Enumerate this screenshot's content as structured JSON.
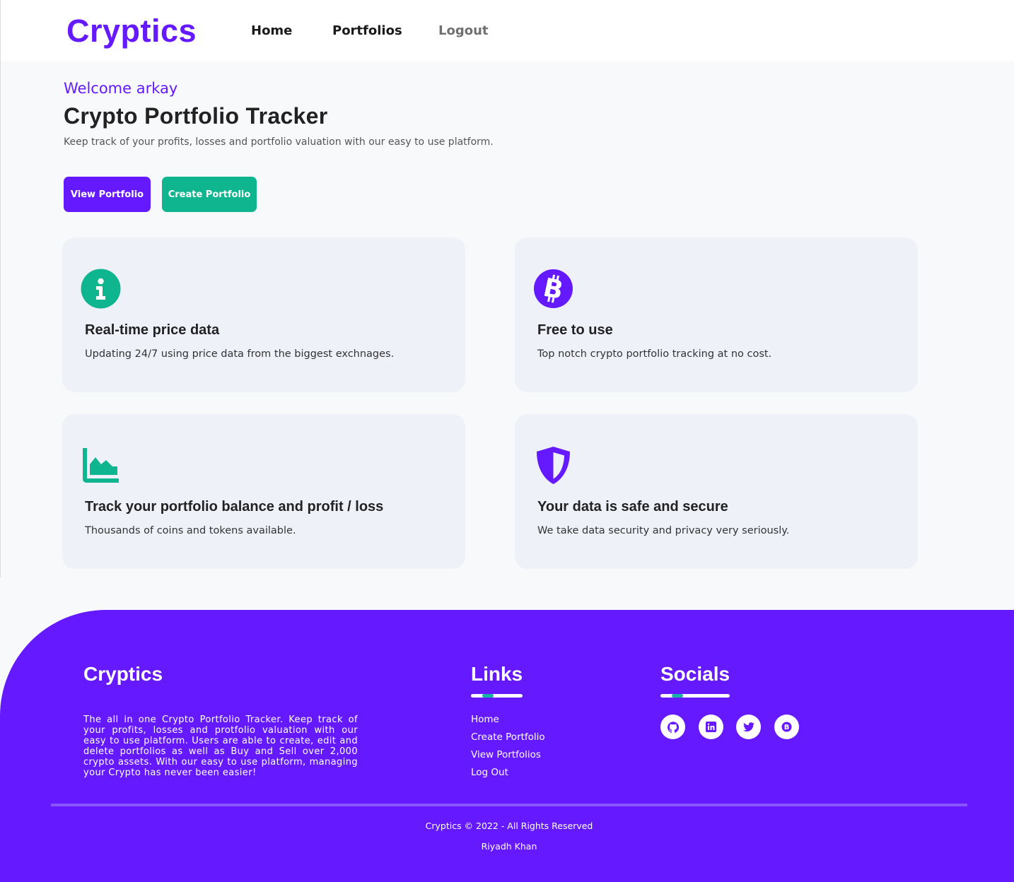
{
  "header": {
    "logo": "Cryptics",
    "nav": [
      {
        "label": "Home"
      },
      {
        "label": "Portfolios"
      },
      {
        "label": "Logout"
      }
    ]
  },
  "hero": {
    "welcome": "Welcome arkay",
    "title": "Crypto Portfolio Tracker",
    "subtitle": "Keep track of your profits, losses and portfolio valuation with our easy to use platform.",
    "buttons": {
      "view": "View Portfolio",
      "create": "Create Portfolio"
    }
  },
  "features": [
    {
      "icon": "info-icon",
      "title": "Real-time price data",
      "desc": "Updating 24/7 using price data from the biggest exchnages."
    },
    {
      "icon": "bitcoin-icon",
      "title": "Free to use",
      "desc": "Top notch crypto portfolio tracking at no cost."
    },
    {
      "icon": "area-chart-icon",
      "title": "Track your portfolio balance and profit / loss",
      "desc": "Thousands of coins and tokens available."
    },
    {
      "icon": "shield-icon",
      "title": "Your data is safe and secure",
      "desc": "We take data security and privacy very seriously."
    }
  ],
  "footer": {
    "brand": "Cryptics",
    "about": "The all in one Crypto Portfolio Tracker. Keep track of your profits, losses and protfolio valuation with our easy to use platform. Users are able to create, edit and delete portfolios as well as Buy and Sell over 2,000 crypto assets. With our easy to use platform, managing your Crypto has never been easier!",
    "links_heading": "Links",
    "links": [
      "Home",
      "Create Portfolio",
      "View Portfolios",
      "Log Out"
    ],
    "socials_heading": "Socials",
    "socials": [
      "github-icon",
      "linkedin-icon",
      "twitter-icon",
      "bitcoin-icon"
    ],
    "copyright": "Cryptics © 2022 - All Rights Reserved",
    "author": "Riyadh Khan"
  },
  "colors": {
    "brand": "#6519ff",
    "accent": "#0fb58e",
    "card_bg": "#eff1f9"
  }
}
